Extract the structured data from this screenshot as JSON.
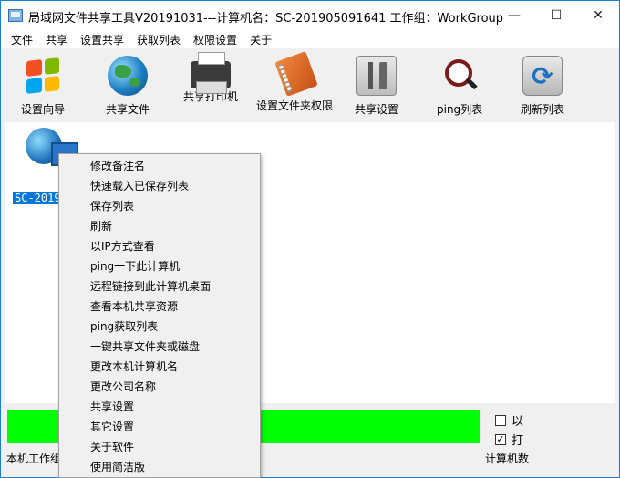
{
  "window": {
    "title": "局域网文件共享工具V20191031---计算机名：SC-201905091641  工作组：WorkGroup",
    "minimize_glyph": "—",
    "maximize_glyph": "☐",
    "close_glyph": "✕"
  },
  "menu": [
    "文件",
    "共享",
    "设置共享",
    "获取列表",
    "权限设置",
    "关于"
  ],
  "toolbar": [
    {
      "label": "设置向导",
      "icon": "windows-flag-icon"
    },
    {
      "label": "共享文件",
      "icon": "globe-icon"
    },
    {
      "label": "共享打印机",
      "icon": "printer-icon"
    },
    {
      "label": "设置文件夹权限",
      "icon": "folder-book-icon"
    },
    {
      "label": "共享设置",
      "icon": "tools-icon"
    },
    {
      "label": "ping列表",
      "icon": "magnifier-icon"
    },
    {
      "label": "刷新列表",
      "icon": "refresh-icon"
    }
  ],
  "computer": {
    "label": "SC-201905091641"
  },
  "context_menu": [
    "修改备注名",
    "快速载入已保存列表",
    "保存列表",
    "刷新",
    "以IP方式查看",
    "ping一下此计算机",
    "远程链接到此计算机桌面",
    "查看本机共享资源",
    "ping获取列表",
    "一键共享文件夹或磁盘",
    "更改本机计算机名",
    "更改公司名称",
    "共享设置",
    "其它设置",
    "关于软件",
    "使用简洁版"
  ],
  "checkboxes": [
    {
      "label": "以",
      "checked": false
    },
    {
      "label": "打",
      "checked": true
    }
  ],
  "status": {
    "left": "本机工作组",
    "right": "计算机数"
  },
  "colors": {
    "progress": "#00ff00",
    "selection": "#0078d7",
    "accent_border": "#1c7dd0"
  }
}
